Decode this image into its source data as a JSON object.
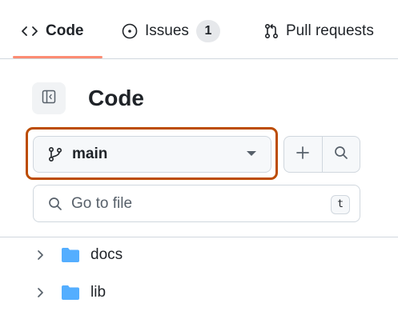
{
  "tabs": [
    {
      "label": "Code",
      "icon": "code-icon"
    },
    {
      "label": "Issues",
      "icon": "issue-opened-icon",
      "count": "1"
    },
    {
      "label": "Pull requests",
      "icon": "git-pull-request-icon"
    }
  ],
  "panel": {
    "title": "Code",
    "toggle_icon": "sidebar-collapse-icon"
  },
  "branch": {
    "name": "main",
    "icon": "git-branch-icon"
  },
  "actions": {
    "add_icon": "plus-icon",
    "search_icon": "search-icon"
  },
  "goto": {
    "placeholder": "Go to file",
    "shortcut": "t"
  },
  "tree": [
    {
      "name": "docs",
      "type": "folder"
    },
    {
      "name": "lib",
      "type": "folder"
    }
  ],
  "colors": {
    "active_tab_underline": "#fd8c73",
    "highlight_border": "#bc4c00",
    "folder": "#54aeff",
    "border": "#d0d7de"
  }
}
